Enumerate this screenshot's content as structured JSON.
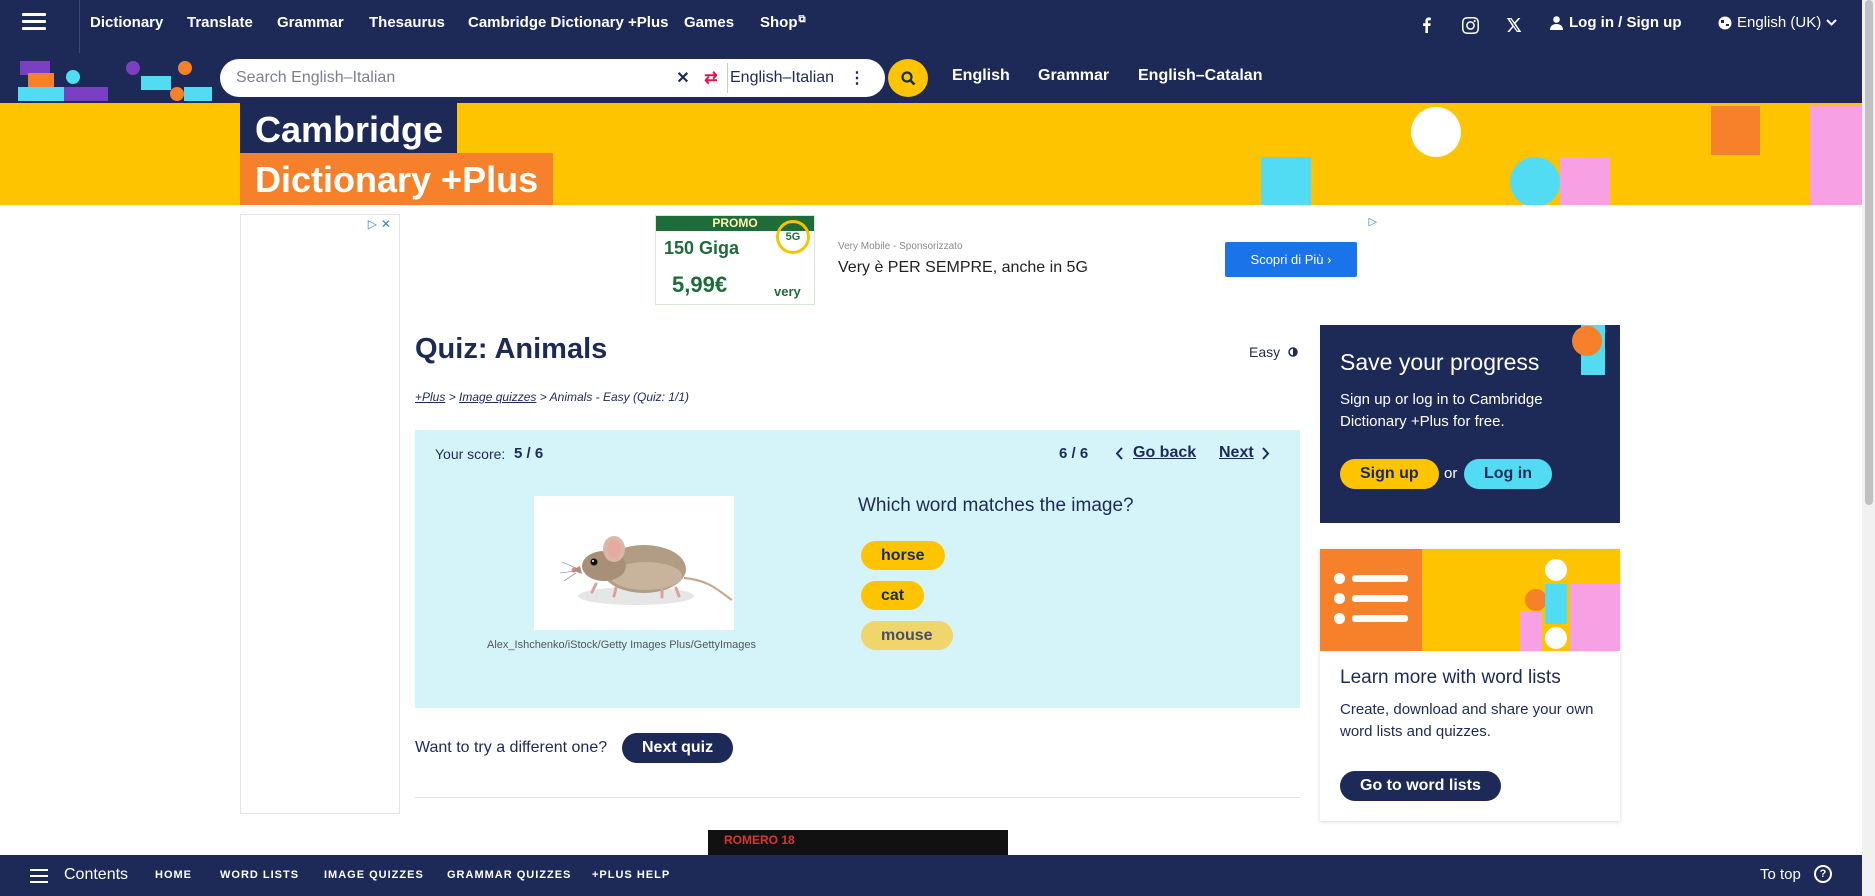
{
  "nav": {
    "items": [
      {
        "label": "Dictionary"
      },
      {
        "label": "Translate"
      },
      {
        "label": "Grammar"
      },
      {
        "label": "Thesaurus"
      },
      {
        "label": "Cambridge Dictionary +Plus"
      },
      {
        "label": "Games"
      },
      {
        "label": "Shop"
      }
    ],
    "login_label": "Log in / Sign up",
    "language": "English (UK)"
  },
  "search": {
    "placeholder": "Search English–Italian",
    "dictionary": "English–Italian",
    "quick_links": [
      "English",
      "Grammar",
      "English–Catalan"
    ]
  },
  "banner": {
    "line1": "Cambridge",
    "line2": "Dictionary +Plus"
  },
  "top_ad": {
    "promo_header": "PROMO",
    "promo_big": "150 Giga",
    "promo_price": "5,99€",
    "promo_badge": "5G",
    "promo_brand": "very",
    "sponsor": "Very Mobile - Sponsorizzato",
    "headline": "Very è PER SEMPRE, anche in 5G",
    "cta": "Scopri di Più  ›"
  },
  "quiz": {
    "title": "Quiz: Animals",
    "level": "Easy",
    "breadcrumb": {
      "plus": "+Plus",
      "sep1": " > ",
      "image_quizzes": "Image quizzes",
      "rest": " > Animals - Easy (Quiz: 1/1)"
    },
    "score_label": "Your score:",
    "score_value": "5 / 6",
    "progress": "6 / 6",
    "go_back": "Go back",
    "next": "Next",
    "image_credit": "Alex_Ishchenko/iStock/Getty Images Plus/GettyImages",
    "question": "Which word matches the image?",
    "options": [
      "horse",
      "cat",
      "mouse"
    ],
    "try_text": "Want to try a different one?",
    "next_quiz": "Next quiz"
  },
  "bottom_ad": {
    "text": "ROMERO 18"
  },
  "sidebar": {
    "progress_title": "Save your progress",
    "progress_text": "Sign up or log in to Cambridge Dictionary +Plus for free.",
    "signup": "Sign up",
    "or": "or",
    "login": "Log in",
    "wordlists_title": "Learn more with word lists",
    "wordlists_text": "Create, download and share your own word lists and quizzes.",
    "wordlists_button": "Go to word lists"
  },
  "bottombar": {
    "contents": "Contents",
    "links": [
      "HOME",
      "WORD LISTS",
      "IMAGE QUIZZES",
      "GRAMMAR QUIZZES",
      "+PLUS HELP"
    ],
    "to_top": "To top",
    "help": "?"
  },
  "colors": {
    "navy": "#1d2a57",
    "yellow": "#fec400",
    "orange": "#f7812a",
    "cyan": "#52dcf4",
    "pink": "#f7a1e4",
    "quiz_bg": "#d5f4fa"
  },
  "icons": [
    "menu-icon",
    "facebook-icon",
    "instagram-icon",
    "x-icon",
    "user-icon",
    "globe-icon",
    "chevron-down-icon",
    "clear-icon",
    "swap-icon",
    "more-icon",
    "search-icon",
    "contrast-icon",
    "chevron-left-icon",
    "chevron-right-icon",
    "help-icon",
    "external-link-icon"
  ]
}
